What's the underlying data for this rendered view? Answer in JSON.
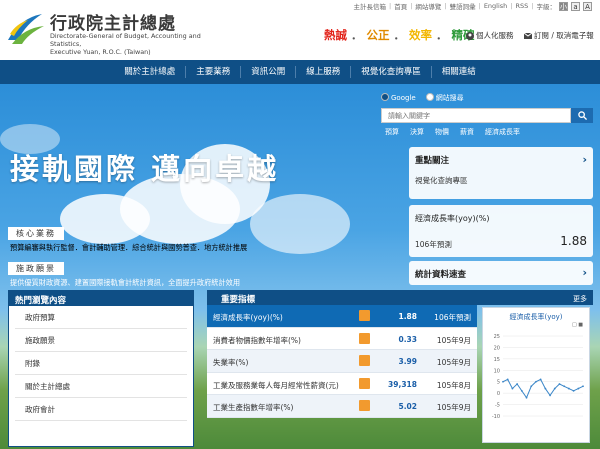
{
  "header": {
    "org_cn": "行政院主計總處",
    "org_en_line1": "Directorate-General of Budget, Accounting and Statistics,",
    "org_en_line2": "Executive Yuan, R.O.C. (Taiwan)",
    "toplinks": [
      "主計長信箱",
      "首頁",
      "網站導覽",
      "雙語詞彙",
      "English",
      "RSS",
      "字級："
    ],
    "font_sizes": [
      "小",
      "a",
      "A"
    ],
    "slogan": [
      {
        "text": "熱誠",
        "color": "#e2231a"
      },
      {
        "text": "公正",
        "color": "#e08a00"
      },
      {
        "text": "效率",
        "color": "#f2b600"
      },
      {
        "text": "精確",
        "color": "#2e9b3a"
      }
    ],
    "personal_service": "個人化服務",
    "subscribe": "訂閱 / 取消電子報"
  },
  "nav": [
    "關於主計總處",
    "主要業務",
    "資訊公開",
    "線上服務",
    "視覺化查詢專區",
    "相關連結"
  ],
  "hero": {
    "title": "接軌國際  邁向卓越",
    "search": {
      "options": [
        "Google",
        "網站搜尋"
      ],
      "placeholder": "請輸入關鍵字",
      "hot_keywords": [
        "預算",
        "決算",
        "物價",
        "薪資",
        "經濟成長率"
      ]
    },
    "core_business_tag": "核心業務",
    "core_business_text": "預算編審與執行監督．會計輔助管理．綜合統計與國勢普查．地方統計推展",
    "vision_tag": "施政願景",
    "vision_text": "提供優質財政資源、建置國際接軌會計統計資訊，全面提升政府統計效用"
  },
  "cards": {
    "focus_title": "重點關注",
    "focus_link": "視覺化查詢專區",
    "gdp_title": "經濟成長率(yoy)(%)",
    "gdp_period": "106年預測",
    "gdp_value": "1.88",
    "quick_stats": "統計資料速查"
  },
  "hot_panel": {
    "title": "熱門瀏覽內容",
    "items": [
      "政府預算",
      "施政願景",
      "附錄",
      "關於主計總處",
      "政府會計"
    ]
  },
  "indicators": {
    "title": "重要指標",
    "more": "更多",
    "rows": [
      {
        "name": "經濟成長率(yoy)(%)",
        "value": "1.88",
        "period": "106年預測"
      },
      {
        "name": "消費者物價指數年增率(%)",
        "value": "0.33",
        "period": "105年9月"
      },
      {
        "name": "失業率(%)",
        "value": "3.99",
        "period": "105年9月"
      },
      {
        "name": "工業及服務業每人每月經常性薪資(元)",
        "value": "39,318",
        "period": "105年8月"
      },
      {
        "name": "工業生產指數年增率(%)",
        "value": "5.02",
        "period": "105年9月"
      }
    ]
  },
  "chart_data": {
    "type": "line",
    "title": "經濟成長率(yoy)",
    "yticks": [
      "25",
      "20",
      "15",
      "10",
      "5",
      "0",
      "-5",
      "-10"
    ],
    "ylim": [
      -10,
      25
    ],
    "values": [
      5,
      6,
      2,
      4,
      1,
      -2,
      3,
      5,
      6,
      2,
      -1,
      2,
      4,
      3,
      2,
      1,
      2,
      3
    ],
    "legend": "□ ■"
  }
}
